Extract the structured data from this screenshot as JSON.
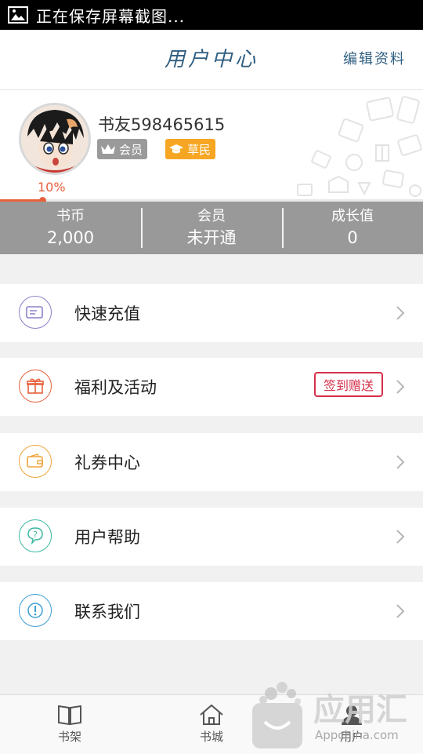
{
  "status_bar": {
    "text": "正在保存屏幕截图..."
  },
  "header": {
    "title": "用户中心",
    "edit_label": "编辑资料"
  },
  "profile": {
    "username": "书友598465615",
    "member_badge": "会员",
    "grade_badge": "草民",
    "progress_label": "10%",
    "progress": 0.1
  },
  "stats": [
    {
      "label": "书币",
      "value": "2,000"
    },
    {
      "label": "会员",
      "value": "未开通"
    },
    {
      "label": "成长值",
      "value": "0"
    }
  ],
  "menu": {
    "recharge": {
      "label": "快速充值",
      "icon": "card-icon",
      "color": "#8a80c9"
    },
    "welfare": {
      "label": "福利及活动",
      "icon": "gift-icon",
      "color": "#e8603c",
      "tag": "签到赠送"
    },
    "coupon": {
      "label": "礼券中心",
      "icon": "wallet-icon",
      "color": "#f0a43a"
    },
    "help": {
      "label": "用户帮助",
      "icon": "question-icon",
      "color": "#3cb9a0"
    },
    "contact": {
      "label": "联系我们",
      "icon": "exclamation-icon",
      "color": "#3c9fd6"
    }
  },
  "tabs": [
    {
      "label": "书架",
      "icon": "book-icon"
    },
    {
      "label": "书城",
      "icon": "home-icon"
    },
    {
      "label": "用户",
      "icon": "user-icon"
    }
  ],
  "watermark": {
    "brand": "应用汇",
    "domain": "Appchina.com"
  }
}
